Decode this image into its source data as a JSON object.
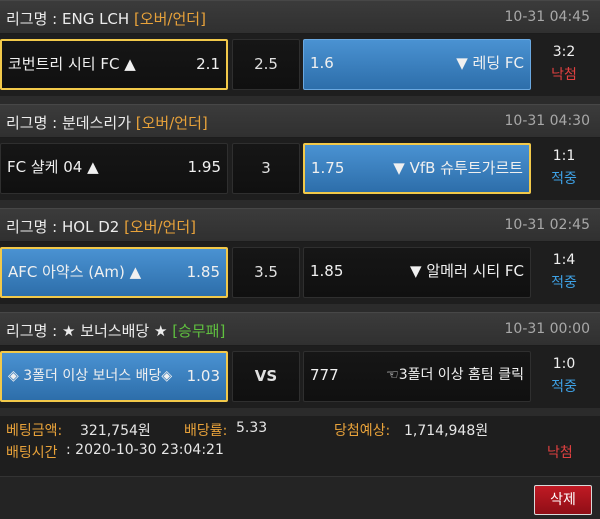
{
  "bets": [
    {
      "league_prefix": "리그명 : ENG LCH ",
      "market": "[오버/언더]",
      "time": "10-31 04:45",
      "home_team": "코번트리 시티 FC ▲",
      "home_odd": "2.1",
      "draw": "2.5",
      "away_odd": "1.6",
      "away_team": "▼ 레딩 FC",
      "score": "3:2",
      "result": "낙첨"
    },
    {
      "league_prefix": "리그명 : 분데스리가 ",
      "market": "[오버/언더]",
      "time": "10-31 04:30",
      "home_team": "FC 샬케 04 ▲",
      "home_odd": "1.95",
      "draw": "3",
      "away_odd": "1.75",
      "away_team": "▼ VfB 슈투트가르트",
      "score": "1:1",
      "result": "적중"
    },
    {
      "league_prefix": "리그명 : HOL D2 ",
      "market": "[오버/언더]",
      "time": "10-31 02:45",
      "home_team": "AFC 아약스 (Am) ▲",
      "home_odd": "1.85",
      "draw": "3.5",
      "away_odd": "1.85",
      "away_team": "▼ 알메러 시티 FC",
      "score": "1:4",
      "result": "적중"
    },
    {
      "league_prefix": "리그명 : ★ 보너스배당 ★ ",
      "market": "[승무패]",
      "time": "10-31 00:00",
      "home_team": "◈ 3폴더 이상 보너스 배당◈",
      "home_odd": "1.03",
      "draw": "VS",
      "away_odd": "777",
      "away_team": "☜3폴더 이상 홈팀 클릭",
      "score": "1:0",
      "result": "적중"
    }
  ],
  "summary": {
    "amount_label": "베팅금액:",
    "amount_value": "321,754원",
    "rate_label": "배당률:",
    "rate_value": "5.33",
    "expected_label": "당첨예상:",
    "expected_value": "1,714,948원",
    "time_label": "배팅시간",
    "time_value": ": 2020-10-30 23:04:21",
    "result": "낙첨"
  },
  "footer": {
    "delete_label": "삭제"
  },
  "colors": {
    "selected_border": "#f2c94a",
    "blue_cell": "#3a80c0",
    "lose": "#e04040",
    "win": "#3ea2e6",
    "market": "#e8a23a",
    "market_win": "#5fbf3f"
  }
}
